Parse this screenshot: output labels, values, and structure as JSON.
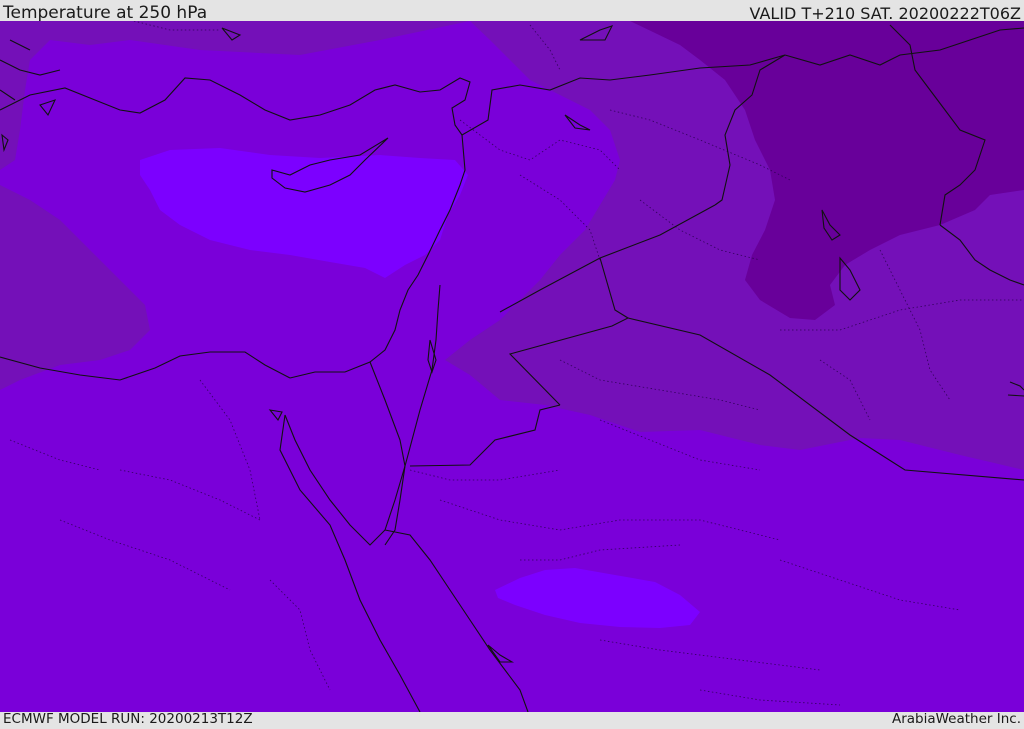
{
  "header": {
    "title": "Temperature at 250 hPa",
    "valid": "VALID T+210 SAT. 20200222T06Z"
  },
  "footer": {
    "model_run": "ECMWF MODEL RUN: 20200213T12Z",
    "credit": "ArabiaWeather Inc."
  },
  "colors": {
    "base_purple": "#7a00d9",
    "warm_purple": "#7410b8",
    "cool_violet": "#7c00ff",
    "deep_purple": "#68009a",
    "outline": "#111111",
    "frame": "#e4e4e4"
  }
}
